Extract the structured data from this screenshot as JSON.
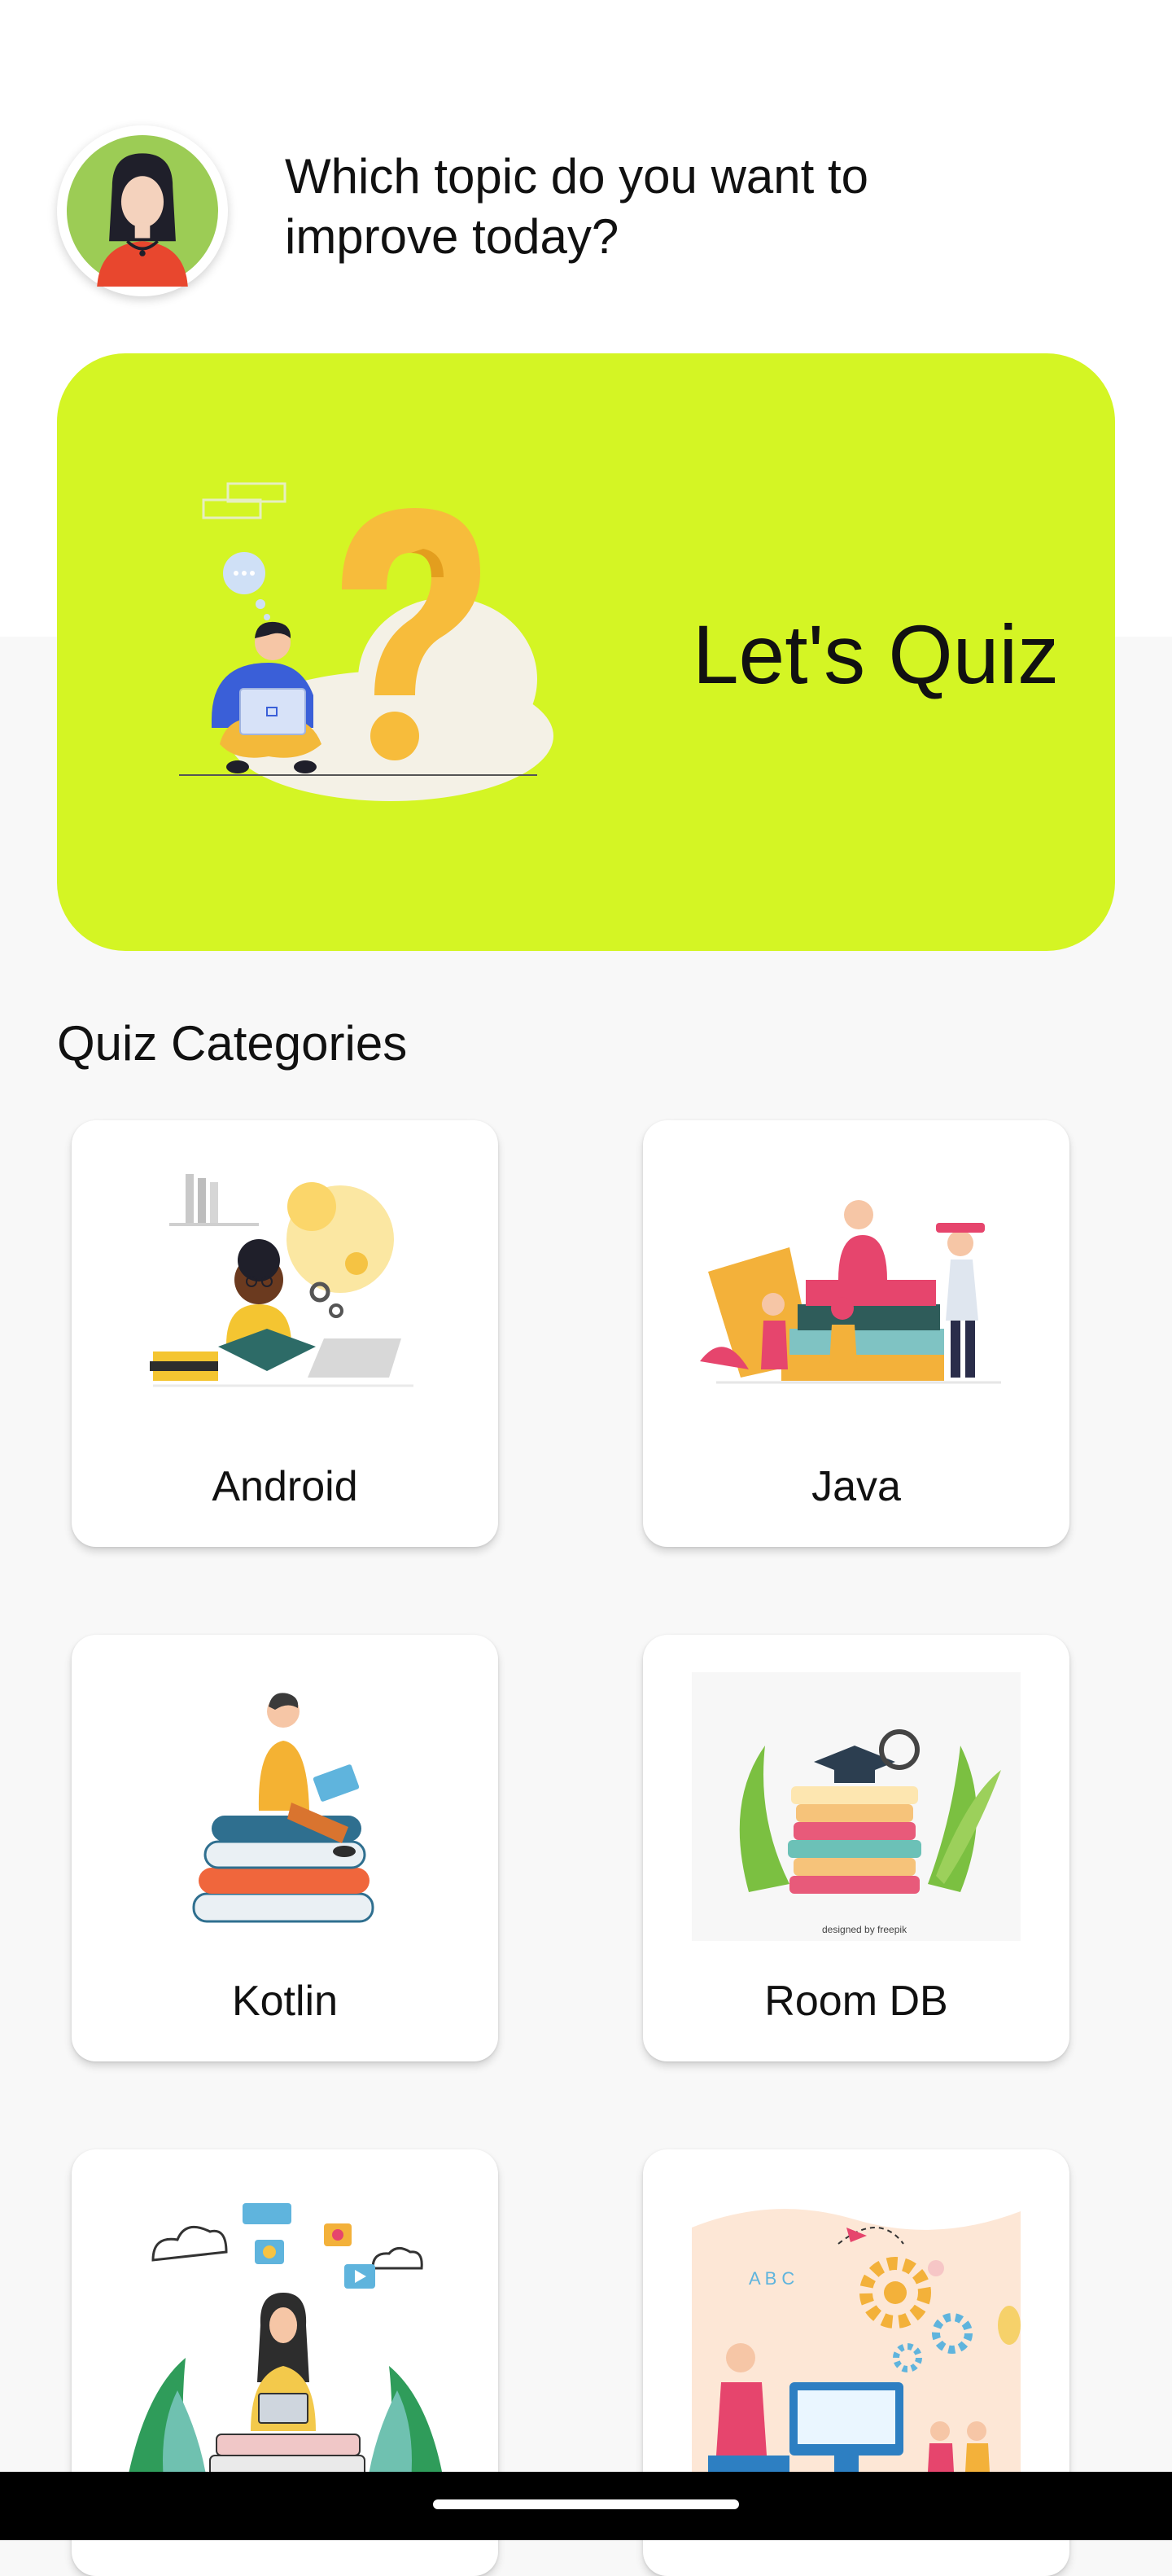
{
  "header": {
    "greeting": "Which topic do you want to improve today?",
    "avatar_icon": "user-avatar-icon"
  },
  "banner": {
    "title": "Let's Quiz",
    "background_color": "#d4f524",
    "illustration": "question-mark-illustration"
  },
  "categories": {
    "title": "Quiz Categories",
    "items": [
      {
        "label": "Android",
        "illustration": "student-reading-illustration"
      },
      {
        "label": "Java",
        "illustration": "books-people-illustration"
      },
      {
        "label": "Kotlin",
        "illustration": "person-on-books-laptop-illustration"
      },
      {
        "label": "Room DB",
        "illustration": "graduation-books-illustration"
      },
      {
        "label": "",
        "illustration": "woman-meditating-laptop-illustration"
      },
      {
        "label": "",
        "illustration": "online-class-gears-illustration"
      }
    ]
  },
  "colors": {
    "accent": "#d4f524",
    "page_background": "#f8f8f8",
    "card_background": "#ffffff"
  }
}
